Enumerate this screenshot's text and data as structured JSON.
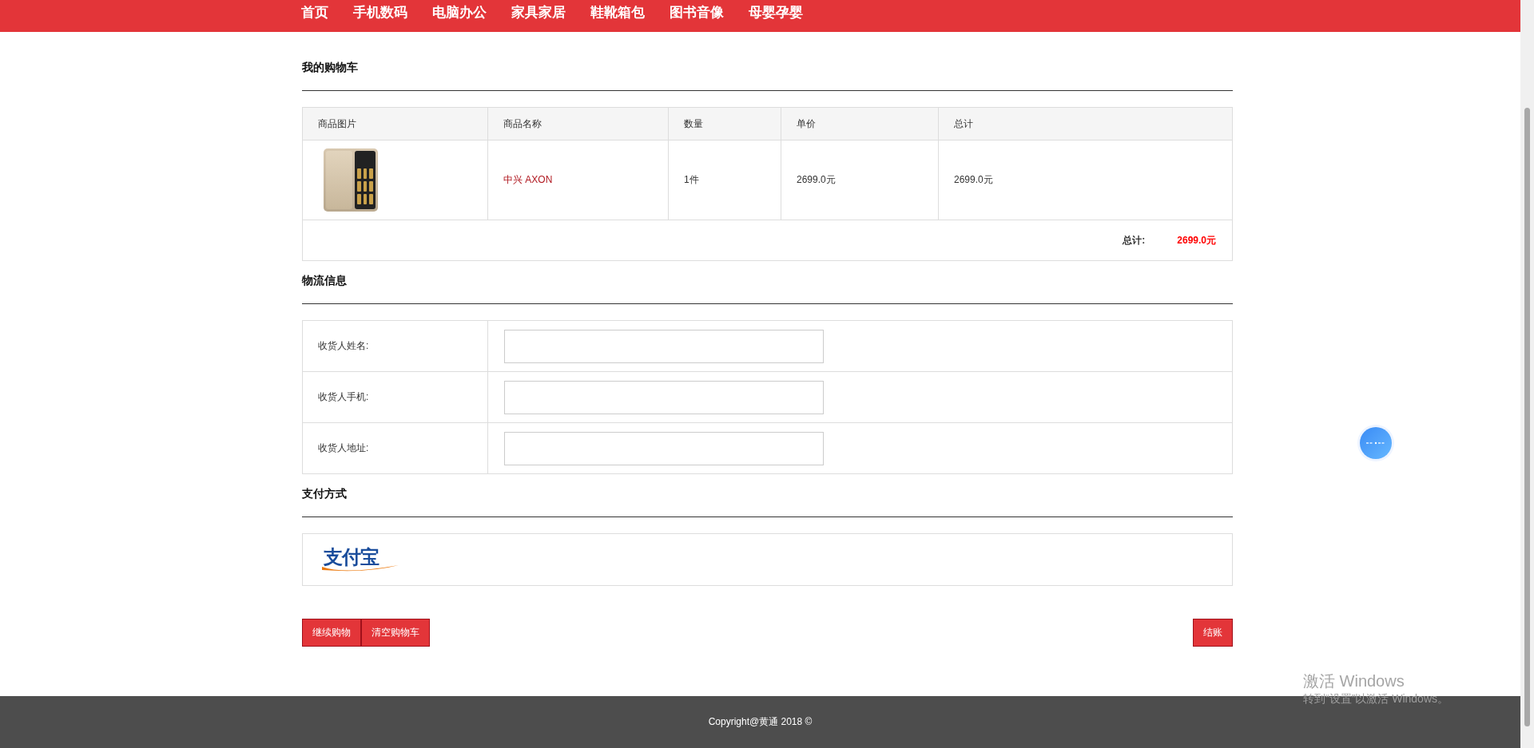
{
  "nav": {
    "items": [
      {
        "label": "首页"
      },
      {
        "label": "手机数码"
      },
      {
        "label": "电脑办公"
      },
      {
        "label": "家具家居"
      },
      {
        "label": "鞋靴箱包"
      },
      {
        "label": "图书音像"
      },
      {
        "label": "母婴孕婴"
      }
    ]
  },
  "cart": {
    "title": "我的购物车",
    "columns": [
      "商品图片",
      "商品名称",
      "数量",
      "单价",
      "总计"
    ],
    "rows": [
      {
        "name": "中兴 AXON",
        "quantity": "1件",
        "unit_price": "2699.0元",
        "total": "2699.0元"
      }
    ],
    "summary": {
      "label": "总计:",
      "value": "2699.0元"
    }
  },
  "shipping": {
    "title": "物流信息",
    "fields": [
      {
        "label": "收货人姓名:"
      },
      {
        "label": "收货人手机:"
      },
      {
        "label": "收货人地址:"
      }
    ]
  },
  "payment": {
    "title": "支付方式",
    "logo_text": "支付宝"
  },
  "actions": {
    "left": [
      "继续购物",
      "清空购物车"
    ],
    "right": [
      "结账"
    ]
  },
  "footer": {
    "text": "Copyright@黄通 2018 ©"
  },
  "os_overlay": {
    "title": "激活 Windows",
    "subtitle": "转到“设置”以激活 Windows。"
  }
}
